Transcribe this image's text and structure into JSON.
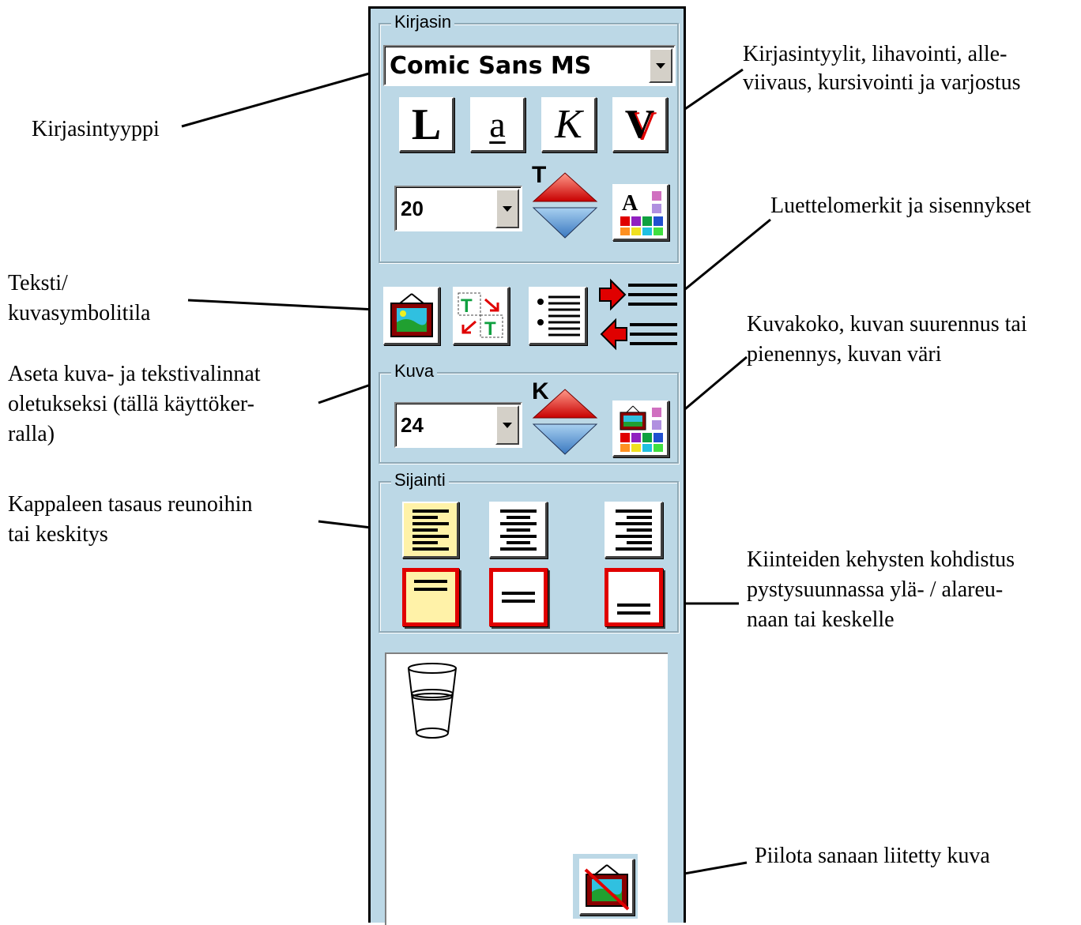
{
  "annotations": {
    "font_type": "Kirjasintyyppi",
    "font_styles": [
      "Kirjasintyylit, lihavointi, alle-",
      "viivaus, kursivointi ja varjostus"
    ],
    "bullets": "Luettelomerkit ja sisennykset",
    "text_symbol_mode": [
      "Teksti/",
      "kuvasymbolitila"
    ],
    "image_size": [
      "Kuvakoko, kuvan suurennus tai",
      "pienennys, kuvan väri"
    ],
    "set_defaults": [
      "Aseta kuva- ja tekstivalinnat",
      "oletukseksi (tällä käyttöker-",
      "ralla)"
    ],
    "paragraph_align": [
      "Kappaleen tasaus reunoihin",
      "tai keskitys"
    ],
    "frame_valign": [
      "Kiinteiden kehysten kohdistus",
      "pystysuunnassa ylä- / alareu-",
      "naan tai keskelle"
    ],
    "hide_image": "Piilota sanaan liitetty kuva"
  },
  "panel": {
    "font_group": {
      "label": "Kirjasin",
      "font_name": "Comic Sans MS",
      "style_buttons": [
        {
          "letter": "L",
          "meaning": "bold"
        },
        {
          "letter": "a",
          "meaning": "underline"
        },
        {
          "letter": "K",
          "meaning": "italic"
        },
        {
          "letter": "V",
          "meaning": "shadow"
        }
      ],
      "font_size": "20",
      "size_arrow_letter": "T",
      "color_button_letter": "A"
    },
    "image_group": {
      "label": "Kuva",
      "image_size": "24",
      "size_arrow_letter": "K"
    },
    "position_group": {
      "label": "Sijainti"
    },
    "colors": {
      "panel_bg": "#bcd8e6",
      "selected_bg": "#fff2a8",
      "frame_red": "#e00000"
    }
  }
}
